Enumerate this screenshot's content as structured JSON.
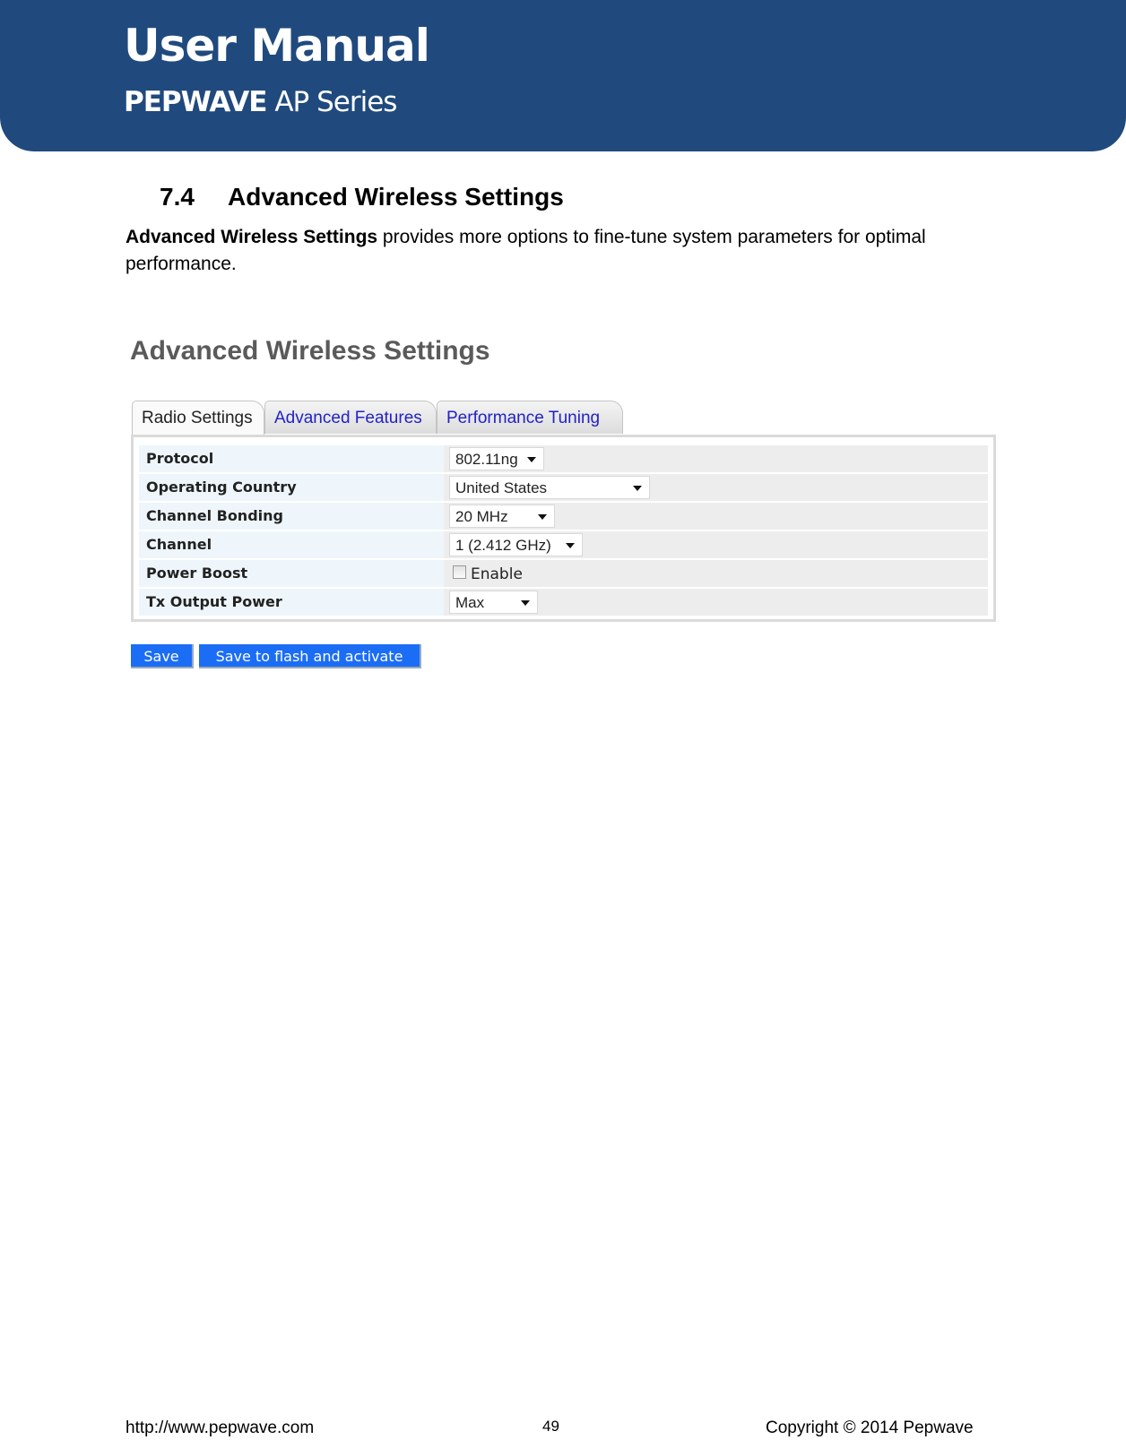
{
  "header": {
    "title": "User Manual",
    "brand": "PEPWAVE",
    "series": "AP Series",
    "background_color": "#204a7e"
  },
  "section": {
    "number": "7.4",
    "title": "Advanced Wireless Settings",
    "intro_bold": "Advanced Wireless Settings",
    "intro_rest": " provides more options to fine-tune system parameters for optimal performance."
  },
  "screenshot": {
    "title": "Advanced Wireless Settings",
    "tabs": [
      {
        "label": "Radio Settings",
        "active": true
      },
      {
        "label": "Advanced Features",
        "active": false
      },
      {
        "label": "Performance Tuning",
        "active": false
      }
    ],
    "rows": [
      {
        "label": "Protocol",
        "type": "select",
        "value": "802.11ng"
      },
      {
        "label": "Operating Country",
        "type": "select",
        "value": "United States"
      },
      {
        "label": "Channel Bonding",
        "type": "select",
        "value": "20 MHz"
      },
      {
        "label": "Channel",
        "type": "select",
        "value": "1 (2.412 GHz)"
      },
      {
        "label": "Power Boost",
        "type": "checkbox",
        "value": "Enable",
        "checked": false
      },
      {
        "label": "Tx Output Power",
        "type": "select",
        "value": "Max"
      }
    ],
    "buttons": {
      "save": "Save",
      "save_activate": "Save to flash and activate"
    },
    "button_color": "#1b6df5",
    "tab_link_color": "#2222c8"
  },
  "footer": {
    "url": "http://www.pepwave.com",
    "page_number": "49",
    "copyright": "Copyright © 2014 Pepwave"
  }
}
